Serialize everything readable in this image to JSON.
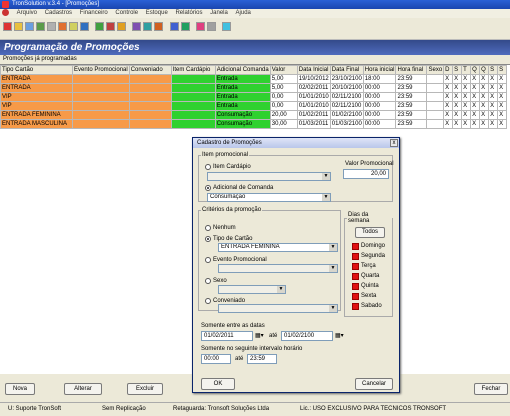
{
  "window": {
    "title": "TronSolution v.3.4 - [Promoções]"
  },
  "menu": [
    "Arquivo",
    "Cadastros",
    "Financeiro",
    "Controle",
    "Estoque",
    "Relatórios",
    "Janela",
    "Ajuda"
  ],
  "header": {
    "title": "Programação de Promoções"
  },
  "subheader": "Promoções já programadas",
  "grid": {
    "columns": [
      "Tipo Cartão",
      "Evento Promocional",
      "Conveniado",
      "Item Cardápio",
      "Adicional Comanda",
      "Valor",
      "Data Inicial",
      "Data Final",
      "Hora inicial",
      "Hora final",
      "Sexo",
      "D",
      "S",
      "T",
      "Q",
      "Q",
      "S",
      "S"
    ],
    "rows": [
      {
        "tipo": "ENTRADA",
        "adicional": "Entrada",
        "valor": "5,00",
        "data_ini": "19/10/2012",
        "data_fim": "23/10/2100",
        "hora_ini": "18:00",
        "hora_fim": "23:59"
      },
      {
        "tipo": "ENTRADA",
        "adicional": "Entrada",
        "valor": "5,00",
        "data_ini": "02/02/2011",
        "data_fim": "20/10/2100",
        "hora_ini": "00:00",
        "hora_fim": "23:59"
      },
      {
        "tipo": "VIP",
        "adicional": "Entrada",
        "valor": "0,00",
        "data_ini": "01/01/2010",
        "data_fim": "02/11/2100",
        "hora_ini": "00:00",
        "hora_fim": "23:59"
      },
      {
        "tipo": "VIP",
        "adicional": "Entrada",
        "valor": "0,00",
        "data_ini": "01/01/2010",
        "data_fim": "02/11/2100",
        "hora_ini": "00:00",
        "hora_fim": "23:59"
      },
      {
        "tipo": "ENTRADA FEMININA",
        "adicional": "Consumação",
        "valor": "20,00",
        "data_ini": "01/02/2011",
        "data_fim": "01/02/2100",
        "hora_ini": "00:00",
        "hora_fim": "23:59"
      },
      {
        "tipo": "ENTRADA MASCULINA",
        "adicional": "Consumação",
        "valor": "30,00",
        "data_ini": "01/03/2011",
        "data_fim": "01/03/2100",
        "hora_ini": "00:00",
        "hora_fim": "23:59"
      }
    ],
    "day_mark": "X"
  },
  "buttons": {
    "nova": "Nova",
    "alterar": "Alterar",
    "excluir": "Excluir",
    "fechar": "Fechar"
  },
  "status": {
    "user": "U: Suporte TronSoft",
    "replication": "Sem Replicação",
    "company": "Retaguarda: Tronsoft Soluções Ltda",
    "license": "Lic.: USO EXCLUSIVO PARA TECNICOS TRONSOFT"
  },
  "dialog": {
    "title": "Cadastro de Promoções",
    "close": "x",
    "item_promocional": {
      "legend": "Item promocional",
      "item_cardapio": "Item Cardápio",
      "adicional_comanda": "Adicional de Comanda",
      "adicional_value": "Consumaçao",
      "valor_label": "Valor Promocional",
      "valor_value": "20,00"
    },
    "criterios": {
      "legend": "Critérios da promoção",
      "nenhum": "Nenhum",
      "tipo_cartao": "Tipo de Cartão",
      "tipo_cartao_value": "ENTRADA FEMININA",
      "evento": "Evento Promocional",
      "sexo": "Sexo",
      "conveniado": "Conveniado"
    },
    "dias": {
      "legend": "Dias da semana",
      "todos": "Todos",
      "days": [
        "Domingo",
        "Segunda",
        "Terça",
        "Quarta",
        "Quinta",
        "Sexta",
        "Sabado"
      ]
    },
    "datas": {
      "label": "Somente entre as datas",
      "from": "01/02/2011",
      "sep": "até",
      "to": "01/02/2100"
    },
    "horario": {
      "label": "Somente no seguinte intervalo horário",
      "from": "00:00",
      "sep": "até",
      "to": "23:59"
    },
    "ok": "OK",
    "cancelar": "Cancelar"
  },
  "colors": {
    "orange": "#f79a48",
    "green": "#2fd12f",
    "header": "#334a8a",
    "red": "#e01010"
  }
}
